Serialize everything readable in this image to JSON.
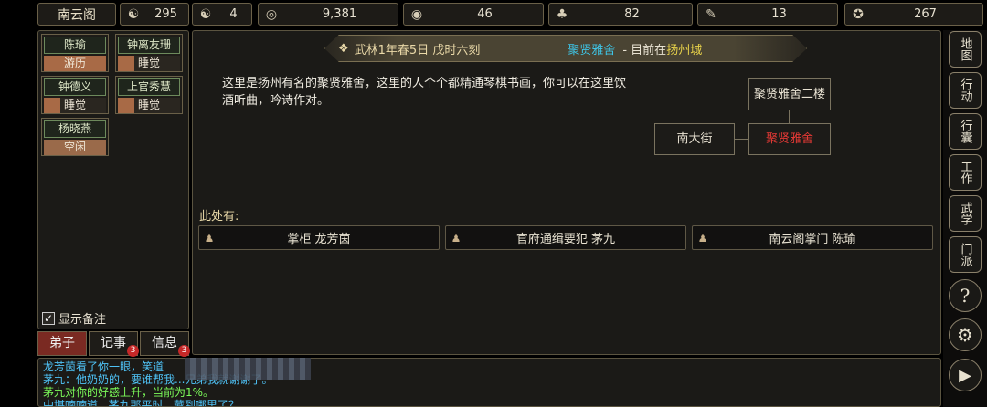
{
  "topbar": {
    "sect_name": "南云阁",
    "stats": [
      {
        "icon": "reputation-icon",
        "glyph": "☯",
        "value": "295"
      },
      {
        "icon": "yin-yang-icon",
        "glyph": "☯",
        "value": "4"
      },
      {
        "icon": "coin-icon",
        "glyph": "◎",
        "value": "9,381"
      },
      {
        "icon": "food-bowl-icon",
        "glyph": "◉",
        "value": "46"
      },
      {
        "icon": "herb-icon",
        "glyph": "♣",
        "value": "82"
      },
      {
        "icon": "scroll-icon",
        "glyph": "✎",
        "value": "13"
      },
      {
        "icon": "ore-icon",
        "glyph": "✪",
        "value": "267"
      }
    ]
  },
  "disciples": [
    {
      "name": "陈瑜",
      "status": "游历",
      "kind": "busy"
    },
    {
      "name": "钟离友珊",
      "status": "睡觉",
      "kind": "sleep"
    },
    {
      "name": "钟德义",
      "status": "睡觉",
      "kind": "sleep"
    },
    {
      "name": "上官秀慧",
      "status": "睡觉",
      "kind": "sleep"
    },
    {
      "name": "杨晓燕",
      "status": "空闲",
      "kind": "idle"
    }
  ],
  "show_notes_label": "显示备注",
  "tabs": [
    {
      "label": "弟子",
      "badge": ""
    },
    {
      "label": "记事",
      "badge": "3"
    },
    {
      "label": "信息",
      "badge": "3"
    }
  ],
  "header": {
    "date": "武林1年春5日 戊时六刻",
    "location_name": "聚贤雅舍",
    "location_prefix": "- 目前在",
    "city": "扬州城"
  },
  "description": "这里是扬州有名的聚贤雅舍，这里的人个个都精通琴棋书画，你可以在这里饮酒听曲，吟诗作对。",
  "map": {
    "north": "聚贤雅舍二楼",
    "west": "南大街",
    "current": "聚贤雅舍"
  },
  "present_label": "此处有:",
  "npcs": [
    "掌柜 龙芳茵",
    "官府通缉要犯 茅九",
    "南云阁掌门 陈瑜"
  ],
  "sidebar": [
    "地图",
    "行动",
    "行囊",
    "工作",
    "武学",
    "门派"
  ],
  "log": [
    {
      "text": "龙芳茵看了你一眼，笑道",
      "color": "#4fc3f7"
    },
    {
      "text": "茅九：他奶奶的，要谁帮我...兄弟我就谢谢了。",
      "color": "#4fc3f7"
    },
    {
      "text": "茅九对你的好感上升，当前为1%。",
      "color": "#7cfc5a"
    },
    {
      "text": "中堪喃喃道...茅九那平时...藏到哪里了？",
      "color": "#4fc3f7"
    }
  ],
  "colors": {
    "accent_gold": "#e8d24a",
    "location_cyan": "#3ec6e8",
    "current_room_red": "#e53935"
  }
}
